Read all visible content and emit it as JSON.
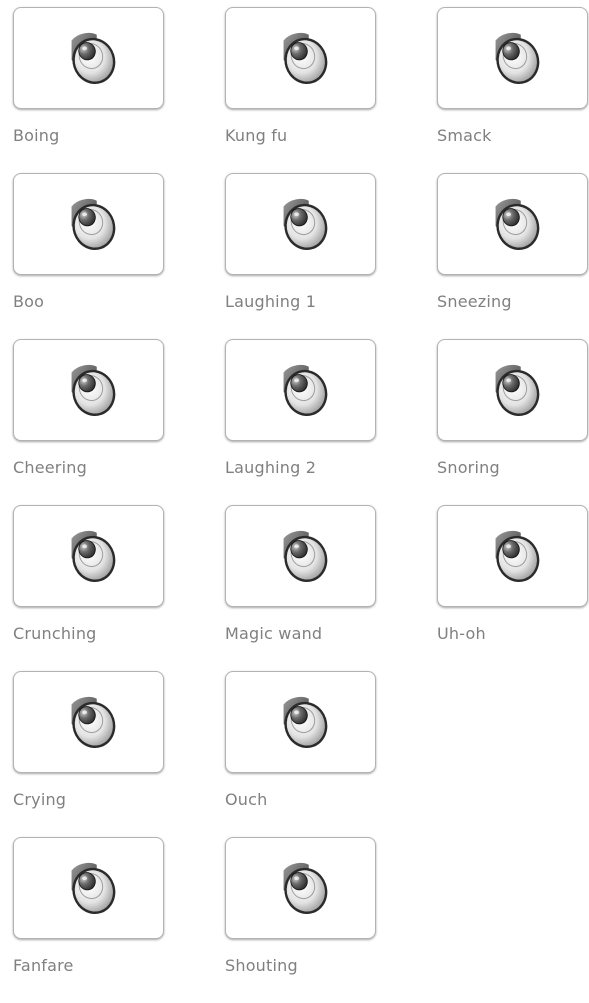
{
  "sounds": [
    {
      "label": "Boing",
      "icon": "speaker-icon"
    },
    {
      "label": "Kung fu",
      "icon": "speaker-icon"
    },
    {
      "label": "Smack",
      "icon": "speaker-icon"
    },
    {
      "label": "Boo",
      "icon": "speaker-icon"
    },
    {
      "label": "Laughing 1",
      "icon": "speaker-icon"
    },
    {
      "label": "Sneezing",
      "icon": "speaker-icon"
    },
    {
      "label": "Cheering",
      "icon": "speaker-icon"
    },
    {
      "label": "Laughing 2",
      "icon": "speaker-icon"
    },
    {
      "label": "Snoring",
      "icon": "speaker-icon"
    },
    {
      "label": "Crunching",
      "icon": "speaker-icon"
    },
    {
      "label": "Magic wand",
      "icon": "speaker-icon"
    },
    {
      "label": "Uh-oh",
      "icon": "speaker-icon"
    },
    {
      "label": "Crying",
      "icon": "speaker-icon"
    },
    {
      "label": "Ouch",
      "icon": "speaker-icon"
    },
    {
      "label": "Fanfare",
      "icon": "speaker-icon"
    },
    {
      "label": "Shouting",
      "icon": "speaker-icon"
    }
  ],
  "colors": {
    "label_text": "#808080",
    "tile_border": "#b3b3b3",
    "tile_background": "#ffffff"
  }
}
